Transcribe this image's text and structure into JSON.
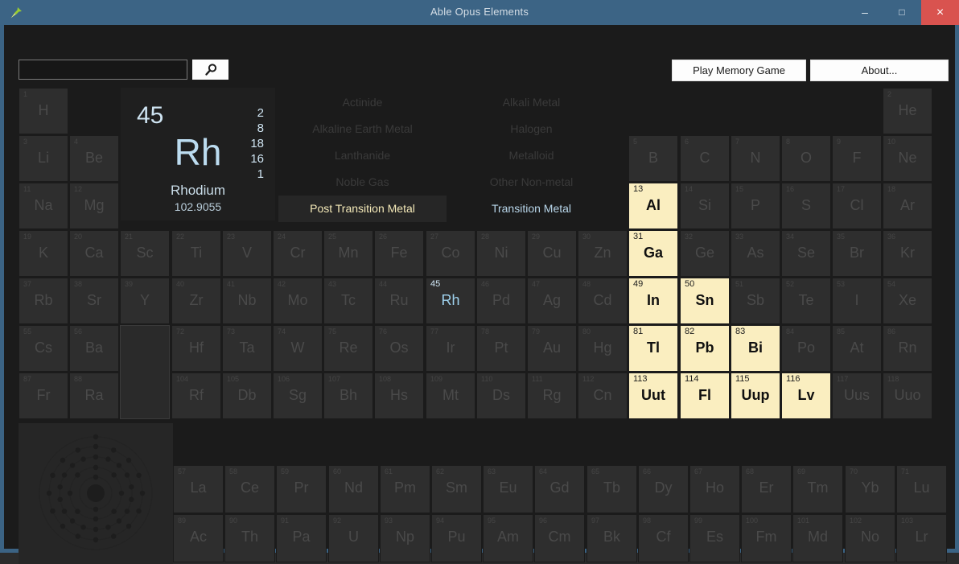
{
  "window": {
    "title": "Able Opus Elements",
    "icon": "pushpin-icon",
    "minimize_label": "–",
    "maximize_label": "□",
    "close_label": "×",
    "close_color": "#d9534f",
    "titlebar_color": "#3c6485"
  },
  "toolbar": {
    "search_value": "",
    "search_placeholder": "",
    "search_icon": "magnifier-icon",
    "memory_game_label": "Play Memory Game",
    "about_label": "About..."
  },
  "detail": {
    "atomic_number": "45",
    "symbol": "Rh",
    "name": "Rhodium",
    "atomic_weight": "102.9055",
    "shells": [
      "2",
      "8",
      "18",
      "16",
      "1"
    ],
    "accent_color": "#bcdcf0"
  },
  "legend": {
    "highlight_color": "#faeec0",
    "items": [
      {
        "label": "Actinide",
        "col": 0,
        "row": 0,
        "state": "dim"
      },
      {
        "label": "Alkali Metal",
        "col": 1,
        "row": 0,
        "state": "dim"
      },
      {
        "label": "Alkaline Earth Metal",
        "col": 0,
        "row": 1,
        "state": "dim"
      },
      {
        "label": "Halogen",
        "col": 1,
        "row": 1,
        "state": "dim"
      },
      {
        "label": "Lanthanide",
        "col": 0,
        "row": 2,
        "state": "dim"
      },
      {
        "label": "Metalloid",
        "col": 1,
        "row": 2,
        "state": "dim"
      },
      {
        "label": "Noble Gas",
        "col": 0,
        "row": 3,
        "state": "dim"
      },
      {
        "label": "Other Non-metal",
        "col": 1,
        "row": 3,
        "state": "dim"
      },
      {
        "label": "Post Transition Metal",
        "col": 0,
        "row": 4,
        "state": "active-post"
      },
      {
        "label": "Transition Metal",
        "col": 1,
        "row": 4,
        "state": "active-trans"
      }
    ]
  },
  "atom_diagram": {
    "label": "bohr-model",
    "shell_counts": [
      2,
      8,
      18,
      16,
      1
    ]
  },
  "table": {
    "selected_symbol": "Rh",
    "highlighted_category": "Post Transition Metal",
    "main": [
      {
        "n": "1",
        "s": "H",
        "g": 1,
        "p": 1
      },
      {
        "n": "2",
        "s": "He",
        "g": 18,
        "p": 1
      },
      {
        "n": "3",
        "s": "Li",
        "g": 1,
        "p": 2
      },
      {
        "n": "4",
        "s": "Be",
        "g": 2,
        "p": 2
      },
      {
        "n": "5",
        "s": "B",
        "g": 13,
        "p": 2
      },
      {
        "n": "6",
        "s": "C",
        "g": 14,
        "p": 2
      },
      {
        "n": "7",
        "s": "N",
        "g": 15,
        "p": 2
      },
      {
        "n": "8",
        "s": "O",
        "g": 16,
        "p": 2
      },
      {
        "n": "9",
        "s": "F",
        "g": 17,
        "p": 2
      },
      {
        "n": "10",
        "s": "Ne",
        "g": 18,
        "p": 2
      },
      {
        "n": "11",
        "s": "Na",
        "g": 1,
        "p": 3
      },
      {
        "n": "12",
        "s": "Mg",
        "g": 2,
        "p": 3
      },
      {
        "n": "13",
        "s": "Al",
        "g": 13,
        "p": 3,
        "hl": true
      },
      {
        "n": "14",
        "s": "Si",
        "g": 14,
        "p": 3
      },
      {
        "n": "15",
        "s": "P",
        "g": 15,
        "p": 3
      },
      {
        "n": "16",
        "s": "S",
        "g": 16,
        "p": 3
      },
      {
        "n": "17",
        "s": "Cl",
        "g": 17,
        "p": 3
      },
      {
        "n": "18",
        "s": "Ar",
        "g": 18,
        "p": 3
      },
      {
        "n": "19",
        "s": "K",
        "g": 1,
        "p": 4
      },
      {
        "n": "20",
        "s": "Ca",
        "g": 2,
        "p": 4
      },
      {
        "n": "21",
        "s": "Sc",
        "g": 3,
        "p": 4
      },
      {
        "n": "22",
        "s": "Ti",
        "g": 4,
        "p": 4
      },
      {
        "n": "23",
        "s": "V",
        "g": 5,
        "p": 4
      },
      {
        "n": "24",
        "s": "Cr",
        "g": 6,
        "p": 4
      },
      {
        "n": "25",
        "s": "Mn",
        "g": 7,
        "p": 4
      },
      {
        "n": "26",
        "s": "Fe",
        "g": 8,
        "p": 4
      },
      {
        "n": "27",
        "s": "Co",
        "g": 9,
        "p": 4
      },
      {
        "n": "28",
        "s": "Ni",
        "g": 10,
        "p": 4
      },
      {
        "n": "29",
        "s": "Cu",
        "g": 11,
        "p": 4
      },
      {
        "n": "30",
        "s": "Zn",
        "g": 12,
        "p": 4
      },
      {
        "n": "31",
        "s": "Ga",
        "g": 13,
        "p": 4,
        "hl": true
      },
      {
        "n": "32",
        "s": "Ge",
        "g": 14,
        "p": 4
      },
      {
        "n": "33",
        "s": "As",
        "g": 15,
        "p": 4
      },
      {
        "n": "34",
        "s": "Se",
        "g": 16,
        "p": 4
      },
      {
        "n": "35",
        "s": "Br",
        "g": 17,
        "p": 4
      },
      {
        "n": "36",
        "s": "Kr",
        "g": 18,
        "p": 4
      },
      {
        "n": "37",
        "s": "Rb",
        "g": 1,
        "p": 5
      },
      {
        "n": "38",
        "s": "Sr",
        "g": 2,
        "p": 5
      },
      {
        "n": "39",
        "s": "Y",
        "g": 3,
        "p": 5
      },
      {
        "n": "40",
        "s": "Zr",
        "g": 4,
        "p": 5
      },
      {
        "n": "41",
        "s": "Nb",
        "g": 5,
        "p": 5
      },
      {
        "n": "42",
        "s": "Mo",
        "g": 6,
        "p": 5
      },
      {
        "n": "43",
        "s": "Tc",
        "g": 7,
        "p": 5
      },
      {
        "n": "44",
        "s": "Ru",
        "g": 8,
        "p": 5
      },
      {
        "n": "45",
        "s": "Rh",
        "g": 9,
        "p": 5,
        "sel": true
      },
      {
        "n": "46",
        "s": "Pd",
        "g": 10,
        "p": 5
      },
      {
        "n": "47",
        "s": "Ag",
        "g": 11,
        "p": 5
      },
      {
        "n": "48",
        "s": "Cd",
        "g": 12,
        "p": 5
      },
      {
        "n": "49",
        "s": "In",
        "g": 13,
        "p": 5,
        "hl": true
      },
      {
        "n": "50",
        "s": "Sn",
        "g": 14,
        "p": 5,
        "hl": true
      },
      {
        "n": "51",
        "s": "Sb",
        "g": 15,
        "p": 5
      },
      {
        "n": "52",
        "s": "Te",
        "g": 16,
        "p": 5
      },
      {
        "n": "53",
        "s": "I",
        "g": 17,
        "p": 5
      },
      {
        "n": "54",
        "s": "Xe",
        "g": 18,
        "p": 5
      },
      {
        "n": "55",
        "s": "Cs",
        "g": 1,
        "p": 6
      },
      {
        "n": "56",
        "s": "Ba",
        "g": 2,
        "p": 6
      },
      {
        "n": "72",
        "s": "Hf",
        "g": 4,
        "p": 6
      },
      {
        "n": "73",
        "s": "Ta",
        "g": 5,
        "p": 6
      },
      {
        "n": "74",
        "s": "W",
        "g": 6,
        "p": 6
      },
      {
        "n": "75",
        "s": "Re",
        "g": 7,
        "p": 6
      },
      {
        "n": "76",
        "s": "Os",
        "g": 8,
        "p": 6
      },
      {
        "n": "77",
        "s": "Ir",
        "g": 9,
        "p": 6
      },
      {
        "n": "78",
        "s": "Pt",
        "g": 10,
        "p": 6
      },
      {
        "n": "79",
        "s": "Au",
        "g": 11,
        "p": 6
      },
      {
        "n": "80",
        "s": "Hg",
        "g": 12,
        "p": 6
      },
      {
        "n": "81",
        "s": "Tl",
        "g": 13,
        "p": 6,
        "hl": true
      },
      {
        "n": "82",
        "s": "Pb",
        "g": 14,
        "p": 6,
        "hl": true
      },
      {
        "n": "83",
        "s": "Bi",
        "g": 15,
        "p": 6,
        "hl": true
      },
      {
        "n": "84",
        "s": "Po",
        "g": 16,
        "p": 6
      },
      {
        "n": "85",
        "s": "At",
        "g": 17,
        "p": 6
      },
      {
        "n": "86",
        "s": "Rn",
        "g": 18,
        "p": 6
      },
      {
        "n": "87",
        "s": "Fr",
        "g": 1,
        "p": 7
      },
      {
        "n": "88",
        "s": "Ra",
        "g": 2,
        "p": 7
      },
      {
        "n": "104",
        "s": "Rf",
        "g": 4,
        "p": 7
      },
      {
        "n": "105",
        "s": "Db",
        "g": 5,
        "p": 7
      },
      {
        "n": "106",
        "s": "Sg",
        "g": 6,
        "p": 7
      },
      {
        "n": "107",
        "s": "Bh",
        "g": 7,
        "p": 7
      },
      {
        "n": "108",
        "s": "Hs",
        "g": 8,
        "p": 7
      },
      {
        "n": "109",
        "s": "Mt",
        "g": 9,
        "p": 7
      },
      {
        "n": "110",
        "s": "Ds",
        "g": 10,
        "p": 7
      },
      {
        "n": "111",
        "s": "Rg",
        "g": 11,
        "p": 7
      },
      {
        "n": "112",
        "s": "Cn",
        "g": 12,
        "p": 7
      },
      {
        "n": "113",
        "s": "Uut",
        "g": 13,
        "p": 7,
        "hl": true
      },
      {
        "n": "114",
        "s": "Fl",
        "g": 14,
        "p": 7,
        "hl": true
      },
      {
        "n": "115",
        "s": "Uup",
        "g": 15,
        "p": 7,
        "hl": true
      },
      {
        "n": "116",
        "s": "Lv",
        "g": 16,
        "p": 7,
        "hl": true
      },
      {
        "n": "117",
        "s": "Uus",
        "g": 17,
        "p": 7
      },
      {
        "n": "118",
        "s": "Uuo",
        "g": 18,
        "p": 7
      }
    ],
    "lanthanides": [
      {
        "n": "57",
        "s": "La"
      },
      {
        "n": "58",
        "s": "Ce"
      },
      {
        "n": "59",
        "s": "Pr"
      },
      {
        "n": "60",
        "s": "Nd"
      },
      {
        "n": "61",
        "s": "Pm"
      },
      {
        "n": "62",
        "s": "Sm"
      },
      {
        "n": "63",
        "s": "Eu"
      },
      {
        "n": "64",
        "s": "Gd"
      },
      {
        "n": "65",
        "s": "Tb"
      },
      {
        "n": "66",
        "s": "Dy"
      },
      {
        "n": "67",
        "s": "Ho"
      },
      {
        "n": "68",
        "s": "Er"
      },
      {
        "n": "69",
        "s": "Tm"
      },
      {
        "n": "70",
        "s": "Yb"
      },
      {
        "n": "71",
        "s": "Lu"
      }
    ],
    "actinides": [
      {
        "n": "89",
        "s": "Ac"
      },
      {
        "n": "90",
        "s": "Th"
      },
      {
        "n": "91",
        "s": "Pa"
      },
      {
        "n": "92",
        "s": "U"
      },
      {
        "n": "93",
        "s": "Np"
      },
      {
        "n": "94",
        "s": "Pu"
      },
      {
        "n": "95",
        "s": "Am"
      },
      {
        "n": "96",
        "s": "Cm"
      },
      {
        "n": "97",
        "s": "Bk"
      },
      {
        "n": "98",
        "s": "Cf"
      },
      {
        "n": "99",
        "s": "Es"
      },
      {
        "n": "100",
        "s": "Fm"
      },
      {
        "n": "101",
        "s": "Md"
      },
      {
        "n": "102",
        "s": "No"
      },
      {
        "n": "103",
        "s": "Lr"
      }
    ]
  }
}
